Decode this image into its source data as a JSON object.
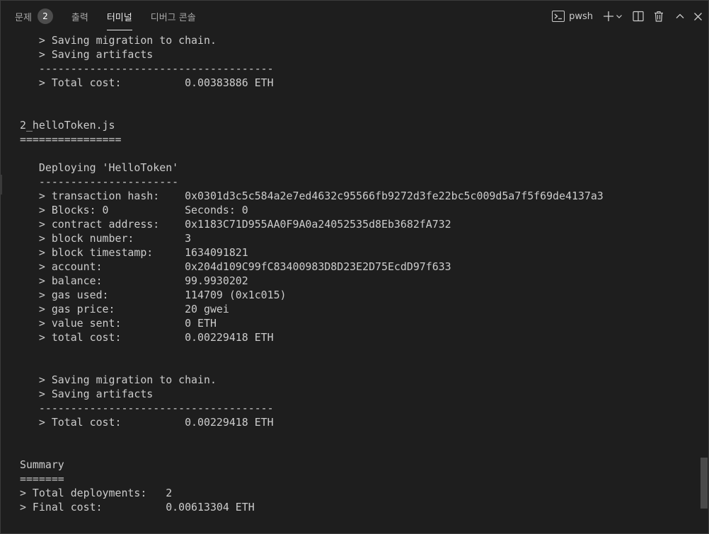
{
  "panel": {
    "tabs": [
      {
        "label": "문제",
        "badge": "2"
      },
      {
        "label": "출력"
      },
      {
        "label": "터미널",
        "active": true
      },
      {
        "label": "디버그 콘솔"
      }
    ],
    "actions": {
      "shell_label": "pwsh",
      "icons": [
        "terminal-icon",
        "plus-icon",
        "chevron-down-icon",
        "split-icon",
        "trash-icon",
        "chevron-up-icon",
        "close-icon"
      ]
    }
  },
  "terminal": {
    "lines": [
      "   > Saving migration to chain.",
      "   > Saving artifacts",
      "   -------------------------------------",
      "   > Total cost:          0.00383886 ETH",
      "",
      "",
      "2_helloToken.js",
      "================",
      "",
      "   Deploying 'HelloToken'",
      "   ----------------------",
      "   > transaction hash:    0x0301d3c5c584a2e7ed4632c95566fb9272d3fe22bc5c009d5a7f5f69de4137a3",
      "   > Blocks: 0            Seconds: 0",
      "   > contract address:    0x1183C71D955AA0F9A0a24052535d8Eb3682fA732",
      "   > block number:        3",
      "   > block timestamp:     1634091821",
      "   > account:             0x204d109C99fC83400983D8D23E2D75EcdD97f633",
      "   > balance:             99.9930202",
      "   > gas used:            114709 (0x1c015)",
      "   > gas price:           20 gwei",
      "   > value sent:          0 ETH",
      "   > total cost:          0.00229418 ETH",
      "",
      "",
      "   > Saving migration to chain.",
      "   > Saving artifacts",
      "   -------------------------------------",
      "   > Total cost:          0.00229418 ETH",
      "",
      "",
      "Summary",
      "=======",
      "> Total deployments:   2",
      "> Final cost:          0.00613304 ETH"
    ]
  }
}
